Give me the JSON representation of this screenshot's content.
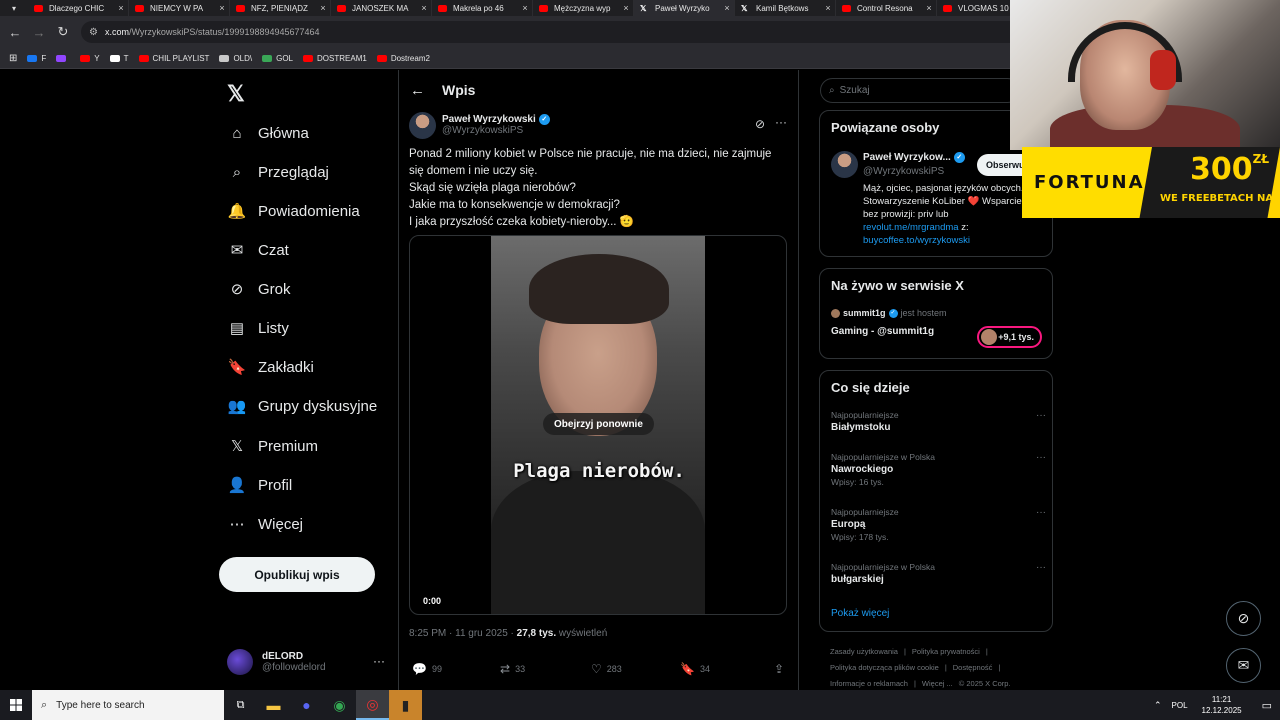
{
  "browser": {
    "tabs": [
      {
        "label": "Dlaczego CHIC",
        "type": "yt"
      },
      {
        "label": "NIEMCY W PA",
        "type": "yt"
      },
      {
        "label": "NFZ, PIENIĄDZ",
        "type": "yt"
      },
      {
        "label": "JANOSZEK MA",
        "type": "yt"
      },
      {
        "label": "Makrela po 46",
        "type": "yt"
      },
      {
        "label": "Mężczyzna wyp",
        "type": "yt"
      },
      {
        "label": "Paweł Wyrzyko",
        "type": "x",
        "active": true
      },
      {
        "label": "Kamil Bętkows",
        "type": "x"
      },
      {
        "label": "Control Resona",
        "type": "yt"
      },
      {
        "label": "VLOGMAS 10",
        "type": "yt"
      }
    ],
    "url_host": "x.com",
    "url_path": "/WyrzykowskiPS/status/1999198894945677464",
    "bookmarks": [
      {
        "label": "F",
        "color": "#1877f2"
      },
      {
        "label": "",
        "color": "#9146ff"
      },
      {
        "label": "Y",
        "color": "#ff0000"
      },
      {
        "label": "T",
        "color": "#ffffff"
      },
      {
        "label": "CHIL PLAYLIST",
        "color": "#ff0000"
      },
      {
        "label": "OLD\\",
        "color": "#c8c8c8"
      },
      {
        "label": "GOL",
        "color": "#3aa757"
      },
      {
        "label": "DOSTREAM1",
        "color": "#ff0000"
      },
      {
        "label": "Dostream2",
        "color": "#ff0000"
      }
    ]
  },
  "nav": {
    "items": [
      {
        "label": "Główna",
        "icon": "home-icon"
      },
      {
        "label": "Przeglądaj",
        "icon": "search-icon"
      },
      {
        "label": "Powiadomienia",
        "icon": "bell-icon"
      },
      {
        "label": "Czat",
        "icon": "mail-icon"
      },
      {
        "label": "Grok",
        "icon": "grok-icon"
      },
      {
        "label": "Listy",
        "icon": "list-icon"
      },
      {
        "label": "Zakładki",
        "icon": "bookmark-icon"
      },
      {
        "label": "Grupy dyskusyjne",
        "icon": "people-icon"
      },
      {
        "label": "Premium",
        "icon": "x-icon"
      },
      {
        "label": "Profil",
        "icon": "person-icon"
      },
      {
        "label": "Więcej",
        "icon": "more-circle-icon"
      }
    ],
    "post_button": "Opublikuj wpis",
    "account": {
      "name": "dELORD",
      "handle": "@followdelord"
    }
  },
  "post": {
    "header_title": "Wpis",
    "author_name": "Paweł Wyrzykowski",
    "author_handle": "@WyrzykowskiPS",
    "text_lines": [
      "Ponad 2 miliony kobiet w Polsce nie pracuje, nie ma dzieci, nie zajmuje",
      "się domem i nie uczy się.",
      "Skąd się wzięła plaga nierobów?",
      "Jakie ma to konsekwencje w demokracji?",
      "I jaka przyszłość czeka kobiety-nieroby... 🫡"
    ],
    "video": {
      "replay_label": "Obejrzyj ponownie",
      "caption": "Plaga nierobów.",
      "time": "0:00"
    },
    "timestamp": "8:25 PM · 11 gru 2025 · ",
    "views_count": "27,8 tys.",
    "views_label": " wyświetleń",
    "stats": {
      "replies": "99",
      "reposts": "33",
      "likes": "283",
      "bookmarks": "34"
    }
  },
  "sidebar": {
    "search_placeholder": "Szukaj",
    "related": {
      "title": "Powiązane osoby",
      "name": "Paweł Wyrzykow...",
      "handle": "@WyrzykowskiPS",
      "follow_label": "Obserwuj",
      "bio_line1": "Mąż, ojciec, pasjonat języków obcych.",
      "bio_line2": "Stowarzyszenie KoLiber ❤️ Wsparcie",
      "bio_line3": "bez prowizji: priv lub",
      "bio_link1": "revolut.me/mrgrandma",
      "bio_link1_suffix": " z:",
      "bio_link2": "buycoffee.to/wyrzykowski"
    },
    "live": {
      "title": "Na żywo w serwisie X",
      "host": "summit1g",
      "host_suffix": "jest hostem",
      "stream_title": "Gaming - @summit1g",
      "listeners": "+9,1 tys."
    },
    "trends": {
      "title": "Co się dzieje",
      "items": [
        {
          "context": "Najpopularniejsze",
          "name": "Białymstoku",
          "count": ""
        },
        {
          "context": "Najpopularniejsze w Polska",
          "name": "Nawrockiego",
          "count": "Wpisy: 16 tys."
        },
        {
          "context": "Najpopularniejsze",
          "name": "Europą",
          "count": "Wpisy: 178 tys."
        },
        {
          "context": "Najpopularniejsze w Polska",
          "name": "bułgarskiej",
          "count": ""
        }
      ],
      "show_more": "Pokaż więcej"
    },
    "footer": {
      "line1a": "Zasady użytkowania",
      "line1b": "Polityka prywatności",
      "line2a": "Polityka dotycząca plików cookie",
      "line2b": "Dostępność",
      "line3a": "Informacje o reklamach",
      "line3b": "Więcej ...",
      "line3c": "© 2025 X Corp."
    }
  },
  "overlay_ad": {
    "brand": "FORTUNA",
    "amount": "300",
    "currency": "ZŁ",
    "tagline": "WE FREEBETACH NA START"
  },
  "taskbar": {
    "search_placeholder": "Type here to search",
    "language": "POL",
    "time": "11:21",
    "date": "12.12.2025"
  }
}
